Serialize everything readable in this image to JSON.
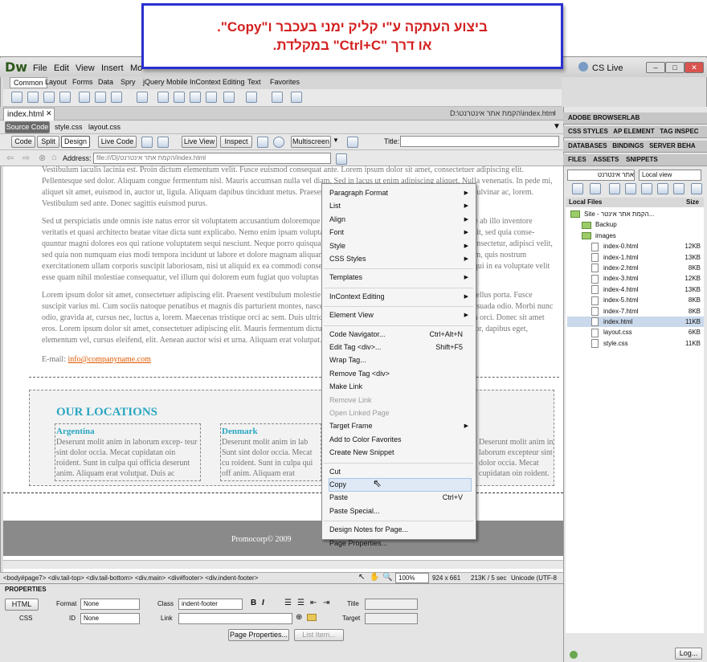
{
  "callout": {
    "line1": "ביצוע העתקה ע\"י קליק ימני בעכבר ו\"Copy\".",
    "line2": "או דרך \"Ctrl+C\" במקלדת."
  },
  "app": {
    "logo": "Dw",
    "cs_live": "CS Live",
    "menus": [
      "File",
      "Edit",
      "View",
      "Insert",
      "Mo"
    ]
  },
  "insert_tabs": [
    "Common",
    "Layout",
    "Forms",
    "Data",
    "Spry",
    "jQuery Mobile",
    "InContext Editing",
    "Text",
    "Favorites"
  ],
  "document": {
    "tab": "index.html",
    "path": "D:\\הקמת אתר אינטרנט\\index.html",
    "related_files": [
      "Source Code",
      "style.css",
      "layout.css"
    ]
  },
  "toolbar": {
    "code": "Code",
    "split": "Split",
    "design": "Design",
    "live_code": "Live Code",
    "live_view": "Live View",
    "inspect": "Inspect",
    "multiscreen": "Multiscreen",
    "title_label": "Title:"
  },
  "address": {
    "label": "Address:",
    "value": "file:///D|/הקמת אתר אינטרנט/index.html"
  },
  "content": {
    "p0": "Vestibulum iaculis lacinia est. Proin dictum elementum velit. Fusce euismod consequat ante. Lorem ipsum dolor sit amet, consectetuer adipiscing elit. Pellentesque sed dolor. Aliquam congue fermentum nisl. Mauris accumsan nulla vel diam. Sed in lacus ut enim adipiscing aliquet. Nulla venenatis. In pede mi, aliquet sit amet, euismod in, auctor ut, ligula. Aliquam dapibus tincidunt metus. Praesent justo dolor, lobortis quis, lobortis dignissim, pulvinar ac, lorem. Vestibulum sed ante. Donec sagittis euismod purus.",
    "p1": "Sed ut perspiciatis unde omnis iste natus error sit voluptatem accusantium doloremque laudantium, totam rem aperiam, eaque ipsa quae ab illo inventore veritatis et quasi architecto beatae vitae dicta sunt explicabo. Nemo enim ipsam voluptatem quia voluptas sit aspernatur aut odit aut fugit, sed quia conse- quuntur magni dolores eos qui ratione voluptatem sequi nesciunt. Neque porro quisquam est, qui dolorem ipsum quia dolor sit amet, consectetur, adipisci velit, sed quia non numquam eius modi tempora incidunt ut labore et dolore magnam aliquam quaerat voluptatem. Ut enim ad minima veniam, quis nostrum exercitationem ullam corporis suscipit laboriosam, nisi ut aliquid ex ea commodi consequatur? Quis autem vel eum iure reprehenderit qui in ea voluptate velit esse quam nihil molestiae consequatur, vel illum qui dolorem eum fugiat quo voluptas nulla pariatur?",
    "p2": "Lorem ipsum dolor sit amet, consectetuer adipiscing elit. Praesent vestibulum molestie lacus. Aenean nonummy hendrerit mauris. Phasellus porta. Fusce suscipit varius mi. Cum sociis natoque penatibus et magnis dis parturient montes, nascetur ridiculus mus. Nulla dui. Fusce feugiat malesuada odio. Morbi nunc odio, gravida at, cursus nec, luctus a, lorem. Maecenas tristique orci ac sem. Duis ultricies pharetra magna. Donec accumsan malesuada orci. Donec sit amet eros. Lorem ipsum dolor sit amet, consectetuer adipiscing elit. Mauris fermentum dictum magna. Sed laoreet aliquam leo. Ut tellus dolor, dapibus eget, elementum vel, cursus eleifend, elit. Aenean auctor wisi et urna. Aliquam erat volutpat. Duis ac turpis. Integer rutrum ante eu lacus.",
    "email_label": "E-mail: ",
    "email": "info@companyname.com",
    "locations_title": "OUR LOCATIONS",
    "loc1_title": "Argentina",
    "loc1_text": "Deserunt molit anim in laborum excep- teur sint dolor occia. Mecat cupidatan oin roident. Sunt in culpa qui officia deserunt anim. Aliquam erat volutpat. Duis ac",
    "loc2_title": "Denmark",
    "loc2_text": "Deserunt molit anim in lab Sunt sint dolor occia. Mecat cu roident. Sunt in culpa qui off anim. Aliquam erat volutpat",
    "loc3_text": "Deserunt molit anim in laborum excepteur sint dolor occia. Mecat cupidatan oin roident. Sunt in culpa qui officia deserunt anim. Aliquam erat volutpat. Duis ac turpis.",
    "footer": "Promocorp© 2009"
  },
  "context_menu": [
    {
      "label": "Paragraph Format",
      "arrow": true
    },
    {
      "label": "List",
      "arrow": true
    },
    {
      "label": "Align",
      "arrow": true
    },
    {
      "label": "Font",
      "arrow": true
    },
    {
      "label": "Style",
      "arrow": true
    },
    {
      "label": "CSS Styles",
      "arrow": true
    },
    {
      "sep": true
    },
    {
      "label": "Templates",
      "arrow": true
    },
    {
      "sep": true
    },
    {
      "label": "InContext Editing",
      "arrow": true
    },
    {
      "sep": true
    },
    {
      "label": "Element View",
      "arrow": true
    },
    {
      "sep": true
    },
    {
      "label": "Code Navigator...",
      "shortcut": "Ctrl+Alt+N"
    },
    {
      "label": "Edit Tag <div>...",
      "shortcut": "Shift+F5"
    },
    {
      "label": "Wrap Tag..."
    },
    {
      "label": "Remove Tag <div>"
    },
    {
      "label": "Make Link"
    },
    {
      "label": "Remove Link",
      "disabled": true
    },
    {
      "label": "Open Linked Page",
      "disabled": true
    },
    {
      "label": "Target Frame",
      "arrow": true
    },
    {
      "label": "Add to Color Favorites"
    },
    {
      "label": "Create New Snippet"
    },
    {
      "sep": true
    },
    {
      "label": "Cut"
    },
    {
      "label": "Copy",
      "hover": true
    },
    {
      "label": "Paste",
      "shortcut": "Ctrl+V"
    },
    {
      "label": "Paste Special..."
    },
    {
      "sep": true
    },
    {
      "label": "Design Notes for Page..."
    },
    {
      "label": "Page Properties..."
    }
  ],
  "status": {
    "tags": "<body#page7> <div.tail-top> <div.tail-bottom> <div.main> <div#footer> <div.indent-footer>",
    "zoom": "100%",
    "dims": "924 x 661",
    "size": "213K / 5 sec",
    "encoding": "Unicode (UTF-8"
  },
  "properties": {
    "title": "PROPERTIES",
    "html": "HTML",
    "css": "CSS",
    "format_label": "Format",
    "format": "None",
    "class_label": "Class",
    "class": "indent-footer",
    "id_label": "ID",
    "id": "None",
    "link_label": "Link",
    "title_label": "Title",
    "target_label": "Target",
    "page_props": "Page Properties...",
    "list_item": "List Item..."
  },
  "panels": {
    "browserlab": "ADOBE BROWSERLAB",
    "css_tabs": [
      "CSS STYLES",
      "AP ELEMENT",
      "TAG INSPEC"
    ],
    "db_tabs": [
      "DATABASES",
      "BINDINGS",
      "SERVER BEHA"
    ],
    "file_tabs": [
      "FILES",
      "ASSETS",
      "SNIPPETS"
    ],
    "site": "אתר אינטרנט",
    "view": "Local view",
    "local_files": "Local Files",
    "size": "Size",
    "log": "Log..."
  },
  "files": [
    {
      "name": "Site - הקמת אתר אינטר...",
      "type": "site"
    },
    {
      "name": "Backup",
      "type": "folder"
    },
    {
      "name": "images",
      "type": "folder"
    },
    {
      "name": "index-0.html",
      "size": "12KB"
    },
    {
      "name": "index-1.html",
      "size": "13KB"
    },
    {
      "name": "index-2.html",
      "size": "8KB"
    },
    {
      "name": "index-3.html",
      "size": "12KB"
    },
    {
      "name": "index-4.html",
      "size": "13KB"
    },
    {
      "name": "index-5.html",
      "size": "8KB"
    },
    {
      "name": "index-7.html",
      "size": "8KB"
    },
    {
      "name": "index.html",
      "size": "11KB",
      "selected": true
    },
    {
      "name": "layout.css",
      "size": "6KB"
    },
    {
      "name": "style.css",
      "size": "11KB"
    }
  ],
  "colors": {
    "callout_text": "#d42020",
    "callout_border": "#2b2fd0",
    "heading": "#2aa7c2",
    "link": "#e05a00"
  }
}
